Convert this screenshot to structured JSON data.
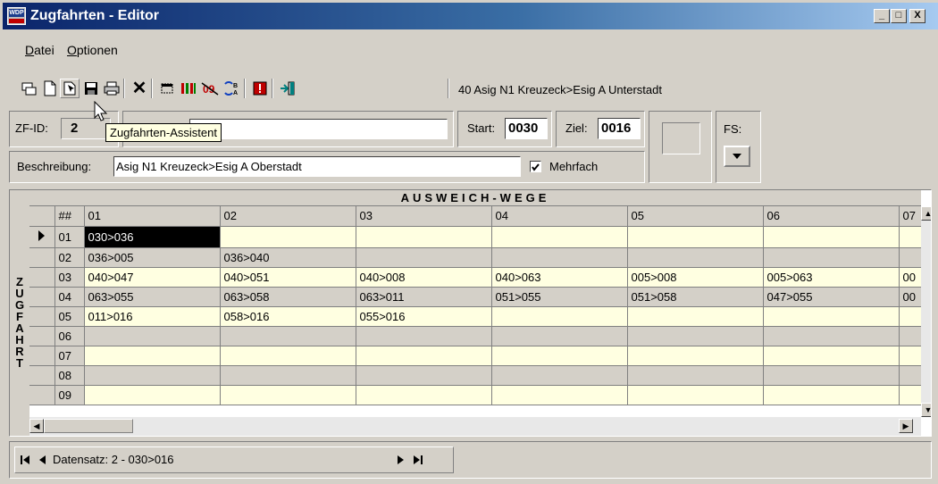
{
  "window": {
    "title": "Zugfahrten - Editor",
    "app_icon_text": "WDP",
    "controls": [
      "_",
      "□",
      "X"
    ]
  },
  "menu": {
    "items": [
      {
        "label": "Datei",
        "accel": "D",
        "rest": "atei"
      },
      {
        "label": "Optionen",
        "accel": "O",
        "rest": "ptionen"
      }
    ]
  },
  "toolbar": {
    "info_label": "40 Asig N1 Kreuzeck>Esig A Unterstadt",
    "icons": [
      "grid-layout-icon",
      "new-document-icon",
      "wizard-icon",
      "save-icon",
      "print-icon",
      "delete-icon",
      "select-region-icon",
      "columns-icon",
      "number-09-icon",
      "ab-swap-icon",
      "warning-icon",
      "exit-icon"
    ]
  },
  "form": {
    "zfid_label": "ZF-ID:",
    "zfid_value": "2",
    "name_value": "",
    "start_label": "Start:",
    "start_value": "0030",
    "ziel_label": "Ziel:",
    "ziel_value": "0016",
    "fs_label": "FS:",
    "beschreibung_label": "Beschreibung:",
    "beschreibung_value": "Asig N1 Kreuzeck>Esig A Oberstadt",
    "mehrfach_label": "Mehrfach",
    "mehrfach_checked": true
  },
  "tooltip": "Zugfahrten-Assistent",
  "grid": {
    "title": "AUSWEICH-WEGE",
    "side_label": [
      "Z",
      "U",
      "G",
      "F",
      "A",
      "H",
      "R",
      "T"
    ],
    "columns": [
      "##",
      "01",
      "02",
      "03",
      "04",
      "05",
      "06",
      "07"
    ],
    "rows": [
      {
        "id": "01",
        "cells": [
          "030>036",
          "",
          "",
          "",
          "",
          "",
          ""
        ]
      },
      {
        "id": "02",
        "cells": [
          "036>005",
          "036>040",
          "",
          "",
          "",
          "",
          ""
        ]
      },
      {
        "id": "03",
        "cells": [
          "040>047",
          "040>051",
          "040>008",
          "040>063",
          "005>008",
          "005>063",
          "00"
        ]
      },
      {
        "id": "04",
        "cells": [
          "063>055",
          "063>058",
          "063>011",
          "051>055",
          "051>058",
          "047>055",
          "00"
        ]
      },
      {
        "id": "05",
        "cells": [
          "011>016",
          "058>016",
          "055>016",
          "",
          "",
          "",
          ""
        ]
      },
      {
        "id": "06",
        "cells": [
          "",
          "",
          "",
          "",
          "",
          "",
          ""
        ]
      },
      {
        "id": "07",
        "cells": [
          "",
          "",
          "",
          "",
          "",
          "",
          ""
        ]
      },
      {
        "id": "08",
        "cells": [
          "",
          "",
          "",
          "",
          "",
          "",
          ""
        ]
      },
      {
        "id": "09",
        "cells": [
          "",
          "",
          "",
          "",
          "",
          "",
          ""
        ]
      }
    ],
    "selected": {
      "row": 0,
      "col": 0
    }
  },
  "navigator": {
    "record_label": "Datensatz: 2 - 030>016"
  },
  "colors": {
    "titlebar_start": "#0a246a",
    "titlebar_end": "#a6caf0",
    "row_odd": "#ffffe1",
    "row_even": "#d4d0c8",
    "face": "#d4d0c8"
  }
}
